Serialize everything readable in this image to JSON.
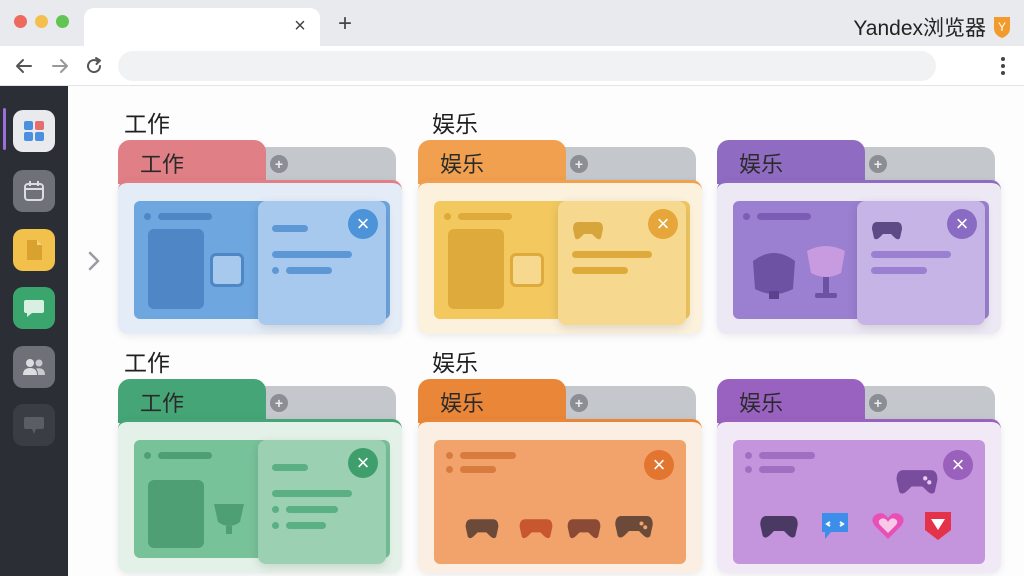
{
  "browser": {
    "brand_name": "Yandex浏览器",
    "brand_logo_letter": "Y",
    "new_tab_symbol": "+",
    "close_tab_symbol": "×"
  },
  "toolbar": {
    "back_icon": "arrow-left-icon",
    "forward_icon": "arrow-right-icon",
    "reload_icon": "reload-icon",
    "address_value": "",
    "menu_icon": "vertical-dots-icon"
  },
  "sidebar": {
    "items": [
      {
        "name": "tab-groups",
        "icon": "grid-icon",
        "bg": "#e9eaee"
      },
      {
        "name": "calendar",
        "icon": "calendar-icon",
        "bg": "#6e7178"
      },
      {
        "name": "notes",
        "icon": "document-icon",
        "bg": "#f2c14b"
      },
      {
        "name": "messenger",
        "icon": "chat-icon",
        "bg": "#3aa66d"
      },
      {
        "name": "contacts",
        "icon": "people-icon",
        "bg": "#6e7178"
      },
      {
        "name": "feedback",
        "icon": "speech-icon",
        "bg": "#3a3d44"
      }
    ]
  },
  "groups": [
    {
      "title": "工作",
      "tab_label": "工作",
      "tab_color": "#e07f86",
      "body_color": "#e4ecf8",
      "bg_panel": "#6ea6df",
      "fg_panel": "#a8c9ee",
      "close_color": "#4d93d9",
      "add_symbol": "+"
    },
    {
      "title": "娱乐",
      "tab_label": "娱乐",
      "tab_color": "#f0a04f",
      "body_color": "#fbf1dc",
      "bg_panel": "#f2c85f",
      "fg_panel": "#f6d98e",
      "close_color": "#e6a63a",
      "add_symbol": "+"
    },
    {
      "title": "",
      "tab_label": "娱乐",
      "tab_color": "#8f6bc2",
      "body_color": "#ece8f4",
      "bg_panel": "#9b7fd0",
      "fg_panel": "#c7b4e6",
      "close_color": "#8a6bc3",
      "add_symbol": "+"
    },
    {
      "title": "工作",
      "tab_label": "工作",
      "tab_color": "#45a576",
      "body_color": "#e3f1e8",
      "bg_panel": "#78c29a",
      "fg_panel": "#9bd0b2",
      "close_color": "#3f9f6c",
      "add_symbol": "+"
    },
    {
      "title": "娱乐",
      "tab_label": "娱乐",
      "tab_color": "#ea8638",
      "body_color": "#fbeee2",
      "bg_panel": "#f2a36c",
      "fg_panel": "#f2a36c",
      "close_color": "#e2752f",
      "add_symbol": "+"
    },
    {
      "title": "",
      "tab_label": "娱乐",
      "tab_color": "#9a62c0",
      "body_color": "#f1e9f6",
      "bg_panel": "#c495dc",
      "fg_panel": "#c495dc",
      "close_color": "#9960bc",
      "add_symbol": "+"
    }
  ],
  "expand_icon": "chevron-right-icon"
}
